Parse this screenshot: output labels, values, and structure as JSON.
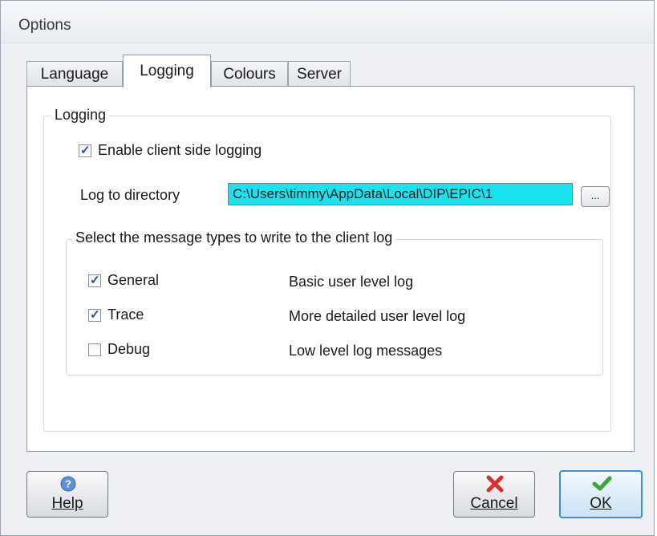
{
  "window": {
    "title": "Options"
  },
  "tabs": [
    {
      "label": "Language",
      "active": false
    },
    {
      "label": "Logging",
      "active": true
    },
    {
      "label": "Colours",
      "active": false
    },
    {
      "label": "Server",
      "active": false
    }
  ],
  "logging": {
    "group_label": "Logging",
    "enable_label": "Enable client side logging",
    "enable_checked": true,
    "dir_label": "Log to directory",
    "dir_value": "C:\\Users\\timmy\\AppData\\Local\\DIP\\EPIC\\1",
    "browse_label": "...",
    "types_group_label": "Select the message types to write to the client log",
    "types": [
      {
        "name": "General",
        "description": "Basic user level log",
        "checked": true
      },
      {
        "name": "Trace",
        "description": "More detailed user level log",
        "checked": true
      },
      {
        "name": "Debug",
        "description": "Low level log messages",
        "checked": false
      }
    ]
  },
  "buttons": {
    "help": "Help",
    "cancel": "Cancel",
    "ok": "OK"
  },
  "colors": {
    "dir_highlight": "#18e4f0",
    "default_button_border": "#3c8fd8",
    "check_mark": "#2a4a9a"
  },
  "icons": {
    "help": "help-circle-icon",
    "cancel": "red-x-icon",
    "ok": "green-check-icon"
  }
}
